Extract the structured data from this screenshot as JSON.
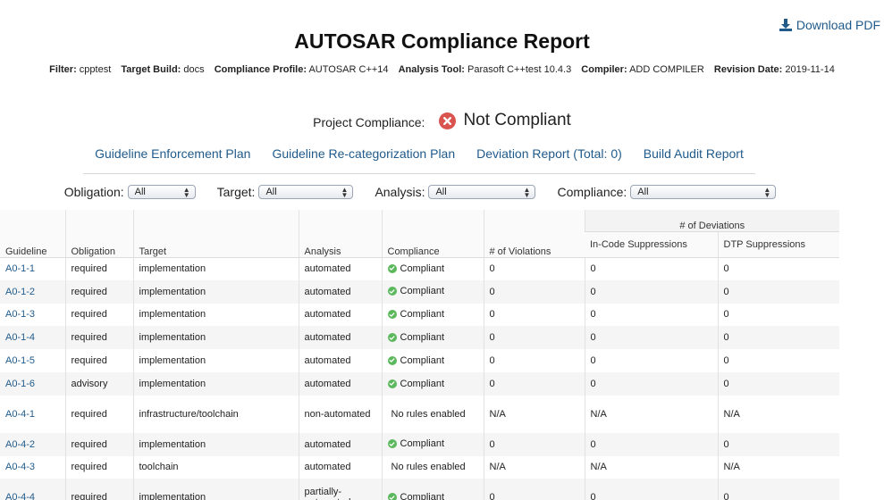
{
  "header": {
    "download_label": "Download PDF",
    "title": "AUTOSAR Compliance Report"
  },
  "meta": [
    {
      "label": "Filter:",
      "value": "cpptest"
    },
    {
      "label": "Target Build:",
      "value": "docs"
    },
    {
      "label": "Compliance Profile:",
      "value": "AUTOSAR C++14"
    },
    {
      "label": "Analysis Tool:",
      "value": "Parasoft C++test 10.4.3"
    },
    {
      "label": "Compiler:",
      "value": "ADD COMPILER"
    },
    {
      "label": "Revision Date:",
      "value": "2019-11-14"
    }
  ],
  "project": {
    "label": "Project Compliance:",
    "status": "Not Compliant",
    "status_color": "#d9534f"
  },
  "links": [
    "Guideline Enforcement Plan",
    "Guideline Re-categorization Plan",
    "Deviation Report (Total: 0)",
    "Build Audit Report"
  ],
  "filters": [
    {
      "label": "Obligation:",
      "value": "All"
    },
    {
      "label": "Target:",
      "value": "All"
    },
    {
      "label": "Analysis:",
      "value": "All"
    },
    {
      "label": "Compliance:",
      "value": "All"
    }
  ],
  "table": {
    "group_header": "# of Deviations",
    "columns": [
      "Guideline",
      "Obligation",
      "Target",
      "Analysis",
      "Compliance",
      "# of Violations",
      "In-Code Suppressions",
      "DTP Suppressions"
    ],
    "rows": [
      [
        "A0-1-1",
        "required",
        "implementation",
        "automated",
        "Compliant",
        "0",
        "0",
        "0"
      ],
      [
        "A0-1-2",
        "required",
        "implementation",
        "automated",
        "Compliant",
        "0",
        "0",
        "0"
      ],
      [
        "A0-1-3",
        "required",
        "implementation",
        "automated",
        "Compliant",
        "0",
        "0",
        "0"
      ],
      [
        "A0-1-4",
        "required",
        "implementation",
        "automated",
        "Compliant",
        "0",
        "0",
        "0"
      ],
      [
        "A0-1-5",
        "required",
        "implementation",
        "automated",
        "Compliant",
        "0",
        "0",
        "0"
      ],
      [
        "A0-1-6",
        "advisory",
        "implementation",
        "automated",
        "Compliant",
        "0",
        "0",
        "0"
      ],
      [
        "A0-4-1",
        "required",
        "infrastructure/toolchain",
        "non-automated",
        "No rules enabled",
        "N/A",
        "N/A",
        "N/A"
      ],
      [
        "A0-4-2",
        "required",
        "implementation",
        "automated",
        "Compliant",
        "0",
        "0",
        "0"
      ],
      [
        "A0-4-3",
        "required",
        "toolchain",
        "automated",
        "No rules enabled",
        "N/A",
        "N/A",
        "N/A"
      ],
      [
        "A0-4-4",
        "required",
        "implementation",
        "partially-automated",
        "Compliant",
        "0",
        "0",
        "0"
      ]
    ]
  },
  "colors": {
    "link": "#1f5a8a",
    "compliant": "#5cb85c",
    "not_compliant": "#d9534f"
  }
}
